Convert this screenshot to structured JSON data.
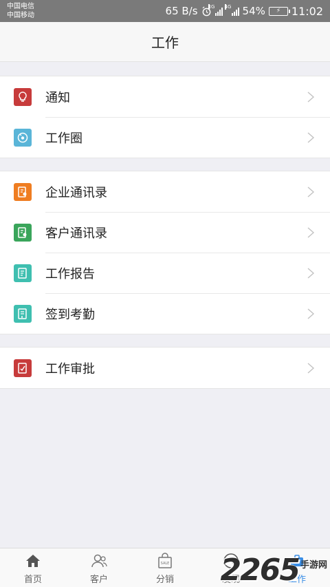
{
  "status": {
    "carrier1": "中国电信",
    "carrier2": "中国移动",
    "speed": "65 B/s",
    "net1": "2G",
    "net2": "4G",
    "battery": "54%",
    "time": "11:02"
  },
  "header": {
    "title": "工作"
  },
  "groups": [
    {
      "items": [
        {
          "label": "通知",
          "icon": "bulb-icon",
          "color": "#c73b3b"
        },
        {
          "label": "工作圈",
          "icon": "circle-icon",
          "color": "#5ab5d8"
        }
      ]
    },
    {
      "items": [
        {
          "label": "企业通讯录",
          "icon": "contacts-icon",
          "color": "#ef7d21"
        },
        {
          "label": "客户通讯录",
          "icon": "customer-contacts-icon",
          "color": "#3aa55b"
        },
        {
          "label": "工作报告",
          "icon": "report-icon",
          "color": "#3fbfb0"
        },
        {
          "label": "签到考勤",
          "icon": "checkin-icon",
          "color": "#3fbfb0"
        }
      ]
    },
    {
      "items": [
        {
          "label": "工作审批",
          "icon": "approval-icon",
          "color": "#c73b3b"
        }
      ]
    }
  ],
  "tabs": [
    {
      "label": "首页",
      "icon": "home-icon"
    },
    {
      "label": "客户",
      "icon": "customer-icon"
    },
    {
      "label": "分销",
      "icon": "sale-bag-icon"
    },
    {
      "label": "发现",
      "icon": "compass-icon"
    },
    {
      "label": "工作",
      "icon": "work-icon",
      "active": true
    }
  ],
  "watermark": {
    "number": "2265",
    "text": "手游网"
  },
  "colors": {
    "active_tab": "#3a8ee6",
    "background": "#efeff4"
  }
}
